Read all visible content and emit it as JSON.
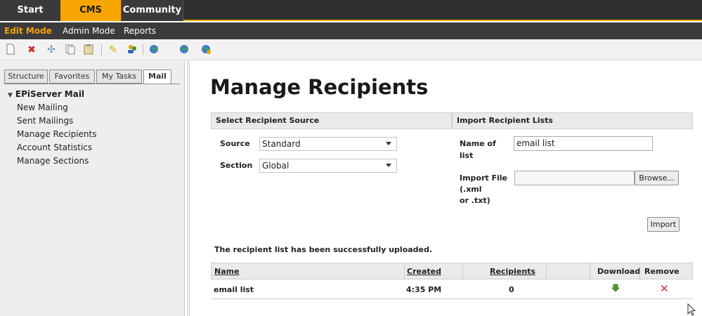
{
  "topnav": {
    "tabs": [
      {
        "label": "Start"
      },
      {
        "label": "CMS"
      },
      {
        "label": "Community"
      }
    ]
  },
  "modes": {
    "edit": "Edit Mode",
    "admin": "Admin Mode",
    "reports": "Reports"
  },
  "toolbar": {
    "icons": [
      "new-page-icon",
      "delete-icon",
      "move-icon",
      "copy-icon",
      "paste-icon",
      "edit-icon",
      "users-icon",
      "globe-icon",
      "globe-back-icon",
      "globe-refresh-icon"
    ]
  },
  "sidebar": {
    "tabs": [
      {
        "label": "Structure"
      },
      {
        "label": "Favorites"
      },
      {
        "label": "My Tasks"
      },
      {
        "label": "Mail"
      }
    ],
    "root": "EPiServer Mail",
    "items": [
      {
        "label": "New Mailing"
      },
      {
        "label": "Sent Mailings"
      },
      {
        "label": "Manage Recipients"
      },
      {
        "label": "Account Statistics"
      },
      {
        "label": "Manage Sections"
      }
    ]
  },
  "main": {
    "title": "Manage Recipients",
    "source_panel": {
      "header": "Select Recipient Source",
      "source_label": "Source",
      "source_value": "Standard",
      "section_label": "Section",
      "section_value": "Global"
    },
    "import_panel": {
      "header": "Import Recipient Lists",
      "name_label_1": "Name of",
      "name_label_2": "list",
      "name_value": "email list",
      "file_label_1": "Import File",
      "file_label_2": "(.xml",
      "file_label_3": "or .txt)",
      "file_value": "",
      "browse": "Browse...",
      "import": "Import"
    },
    "message": "The recipient list has been successfully uploaded.",
    "table": {
      "headers": {
        "name": "Name",
        "created": "Created",
        "recipients": "Recipients",
        "download": "Download",
        "remove": "Remove"
      },
      "rows": [
        {
          "name": "email list",
          "created": "4:35 PM",
          "recipients": "0"
        }
      ]
    }
  },
  "colors": {
    "accent": "#f7a500",
    "nav_bg": "#2f2f2f",
    "remove_red": "#d22b2b",
    "download_green": "#4a9e2c"
  }
}
